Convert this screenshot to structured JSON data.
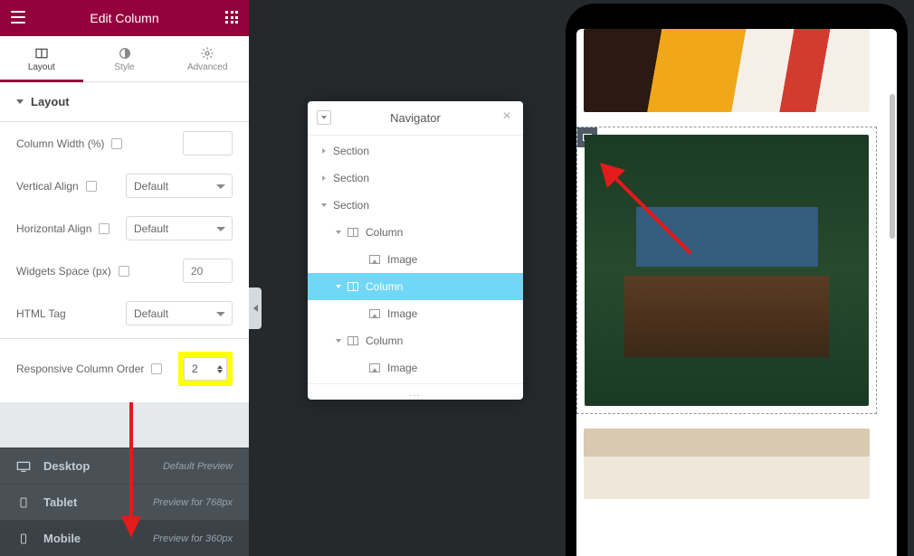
{
  "header": {
    "title": "Edit Column"
  },
  "tabs": {
    "layout": "Layout",
    "style": "Style",
    "advanced": "Advanced",
    "active": "layout"
  },
  "section": {
    "title": "Layout"
  },
  "controls": {
    "columnWidth": {
      "label": "Column Width (%)",
      "value": ""
    },
    "verticalAlign": {
      "label": "Vertical Align",
      "value": "Default"
    },
    "horizontalAlign": {
      "label": "Horizontal Align",
      "value": "Default"
    },
    "widgetsSpace": {
      "label": "Widgets Space (px)",
      "placeholder": "20",
      "value": ""
    },
    "htmlTag": {
      "label": "HTML Tag",
      "value": "Default"
    },
    "responsiveOrder": {
      "label": "Responsive Column Order",
      "value": "2"
    }
  },
  "devices": [
    {
      "id": "desktop",
      "label": "Desktop",
      "desc": "Default Preview",
      "active": false
    },
    {
      "id": "tablet",
      "label": "Tablet",
      "desc": "Preview for 768px",
      "active": false
    },
    {
      "id": "mobile",
      "label": "Mobile",
      "desc": "Preview for 360px",
      "active": true
    }
  ],
  "navigator": {
    "title": "Navigator",
    "footer": "…",
    "tree": [
      {
        "label": "Section",
        "depth": 0,
        "expanded": false,
        "icon": "none"
      },
      {
        "label": "Section",
        "depth": 0,
        "expanded": false,
        "icon": "none"
      },
      {
        "label": "Section",
        "depth": 0,
        "expanded": true,
        "icon": "none"
      },
      {
        "label": "Column",
        "depth": 1,
        "expanded": true,
        "icon": "column"
      },
      {
        "label": "Image",
        "depth": 2,
        "expanded": false,
        "icon": "image",
        "leaf": true
      },
      {
        "label": "Column",
        "depth": 1,
        "expanded": true,
        "icon": "column",
        "selected": true
      },
      {
        "label": "Image",
        "depth": 2,
        "expanded": false,
        "icon": "image",
        "leaf": true
      },
      {
        "label": "Column",
        "depth": 1,
        "expanded": true,
        "icon": "column"
      },
      {
        "label": "Image",
        "depth": 2,
        "expanded": false,
        "icon": "image",
        "leaf": true
      }
    ]
  },
  "select_options": {
    "default_only": [
      "Default"
    ]
  }
}
